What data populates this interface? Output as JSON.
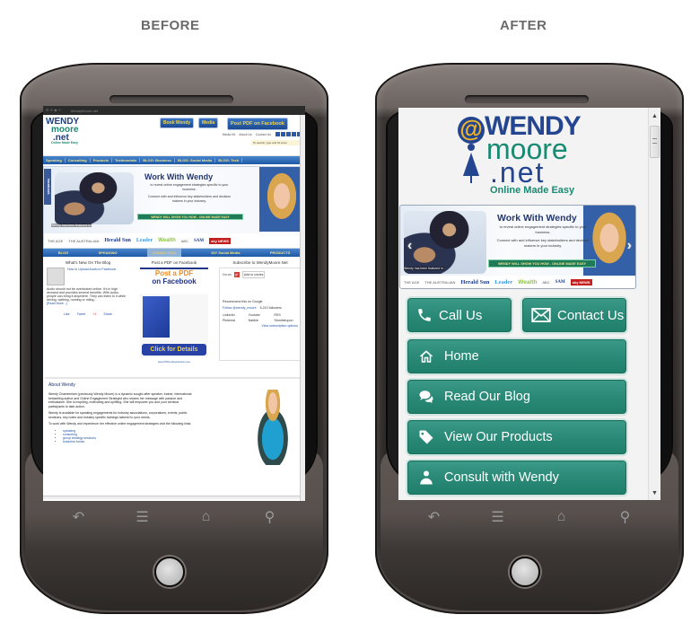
{
  "captions": {
    "before": "BEFORE",
    "after": "AFTER"
  },
  "device_keys": [
    "back-icon",
    "menu-icon",
    "home-icon",
    "search-icon"
  ],
  "before": {
    "statusbar": {
      "tab": "WendyMoore.net"
    },
    "header": {
      "logo": {
        "line1": "WENDY",
        "line2": "moore",
        "line3": ".net",
        "tagline": "Online Made Easy"
      },
      "buttons": [
        "Book Wendy",
        "Media",
        "Post PDF on Facebook"
      ],
      "links": [
        "Media Kit",
        "About Us",
        "Contact Us"
      ],
      "search_placeholder": "To search, type and hit enter"
    },
    "nav": [
      "Speaking",
      "Consulting",
      "Products",
      "Testimonials",
      "BLOG: Business",
      "BLOG: Social Media",
      "BLOG: Tech"
    ],
    "banner": {
      "facebook_tab": "facebook",
      "title": "Work With Wendy",
      "text1": "to reveal online engagement strategies specific to your business.",
      "text2": "Connect with and influence key stakeholders and decision makers in your industry.",
      "strip": "WENDY WILL SHOW YOU HOW - ONLINE MADE EASY",
      "featured": "Wendy has been featured in:",
      "logos": [
        "THE AGE",
        "THE AUSTRALIAN",
        "Herald Sun",
        "Leader",
        "Wealth",
        "ABC",
        "SAM",
        "sky NEWS"
      ]
    },
    "subnav": [
      "BLOG",
      "SPEAKING",
      "CONSULTING",
      "DIY Social Media",
      "PRODUCTS"
    ],
    "subnav_active": "CONSULTING",
    "columns": {
      "blog": {
        "heading": "What's New On The Blog",
        "post_title": "How to Upload Audio to Facebook",
        "excerpt": "Audio should not be overlooked online. It's in high demand and provides several benefits. With audio, people can bring it anywhere. They can listen to it while driving, walking, running or riding...",
        "read_more": "[Read More...]",
        "share": [
          "Like",
          "Tweet",
          "+1",
          "Share"
        ]
      },
      "pdf": {
        "heading": "Post a PDF on Facebook",
        "ad_line1": "Post a PDF",
        "ad_line2": "on Facebook",
        "cta": "Click for Details",
        "url": "www.PDFonFacebook.com"
      },
      "subscribe": {
        "heading": "Subscribe to WendyMoore.Net",
        "gplus": "I'm on",
        "add": "Add to circles",
        "recommend": "Recommend this on Google",
        "twitter": "Follow @wendy_moore",
        "followers": "6,210 followers",
        "networks": [
          "LinkedIn",
          "Youtube",
          "RSS",
          "Pinterest",
          "Nabble",
          "Stumbleupon"
        ],
        "more": "View subscription options"
      }
    },
    "about": {
      "heading": "About Wendy",
      "p1": "Wendy Chamberlain (previously Wendy Moore) is a dynamic sought-after speaker, trainer, international bestselling author and Online Engagement Strategist who shares her message with passion and enthusiasm. She is inspiring, motivating and uplifting. She will empower you and your seminar participants to take action.",
      "p2": "Wendy is available for speaking engagements for industry associations, corporations, events, public seminars, key notes and industry specific trainings tailored to your needs.",
      "p3": "To work with Wendy and experience her effective online engagement strategies visit the following links:",
      "links": [
        "speaking",
        "consulting",
        "group strategy sessions",
        "business books"
      ]
    }
  },
  "after": {
    "logo": {
      "at": "@",
      "line1": "WENDY",
      "line2": "moore",
      "line3": ".net",
      "tagline": "Online Made Easy"
    },
    "banner": {
      "title": "Work With Wendy",
      "text1": "to reveal online engagement strategies specific to your business.",
      "text2": "Connect with and influence key stakeholders and decision makers in your industry.",
      "strip": "WENDY WILL SHOW YOU HOW - ONLINE MADE EASY",
      "featured": "Wendy has been featured in:",
      "logos": [
        "THE AGE",
        "THE AUSTRALIAN",
        "Herald Sun",
        "Leader",
        "Wealth",
        "ABC",
        "SAM",
        "sky NEWS"
      ],
      "prev": "‹",
      "next": "›"
    },
    "buttons": {
      "call": {
        "label": "Call Us",
        "icon": "phone-icon"
      },
      "contact": {
        "label": "Contact Us",
        "icon": "envelope-icon"
      },
      "menu": [
        {
          "label": "Home",
          "icon": "home-icon"
        },
        {
          "label": "Read Our Blog",
          "icon": "chat-bubbles-icon"
        },
        {
          "label": "View Our Products",
          "icon": "tag-icon"
        },
        {
          "label": "Consult with Wendy",
          "icon": "user-icon"
        }
      ]
    },
    "colors": {
      "button_teal": "#2a8a77",
      "brand_blue": "#24458f",
      "brand_green": "#1b8a72",
      "accent_gold": "#f0b429"
    }
  }
}
